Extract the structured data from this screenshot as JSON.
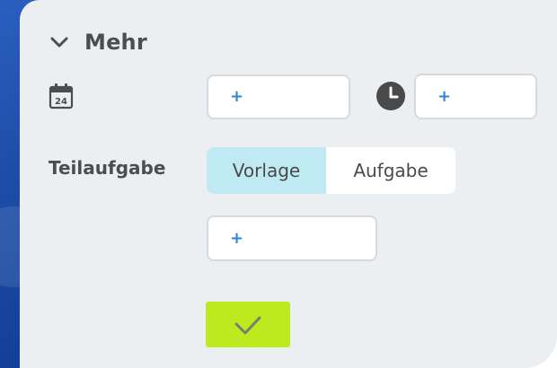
{
  "section": {
    "title": "Mehr",
    "icon": "chevron-down-icon"
  },
  "date_row": {
    "calendar_icon": "calendar-icon",
    "calendar_day": "24",
    "date_add": "+",
    "clock_icon": "clock-icon",
    "time_add": "+"
  },
  "subtask": {
    "label": "Teilaufgabe",
    "options": [
      {
        "label": "Vorlage",
        "selected": true
      },
      {
        "label": "Aufgabe",
        "selected": false
      }
    ],
    "add": "+"
  },
  "confirm": {
    "icon": "checkmark-icon"
  },
  "colors": {
    "panel": "#eceff2",
    "accent_plus": "#2f84d6",
    "selected_segment": "#bfeaf3",
    "confirm_button": "#bdea1e",
    "text": "#4d4d4d"
  }
}
